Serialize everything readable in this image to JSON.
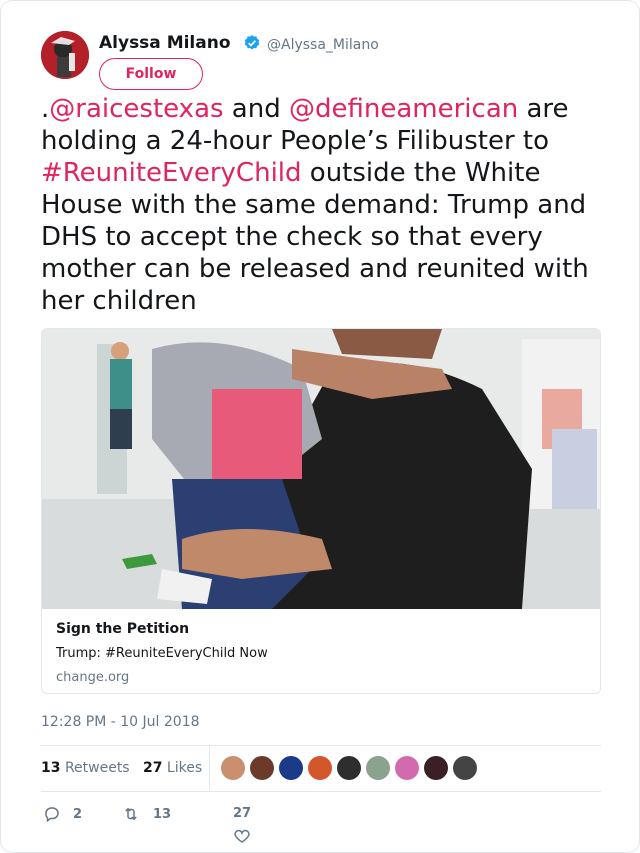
{
  "author": {
    "name": "Alyssa Milano",
    "handle": "@Alyssa_Milano",
    "follow_label": "Follow"
  },
  "tweet": {
    "parts": [
      {
        "text": ".",
        "link": false
      },
      {
        "text": "@raicestexas",
        "link": true
      },
      {
        "text": " and ",
        "link": false
      },
      {
        "text": "@defineamerican",
        "link": true
      },
      {
        "text": " are holding a 24-hour People’s Filibuster to ",
        "link": false
      },
      {
        "text": "#ReuniteEveryChild",
        "link": true
      },
      {
        "text": " outside the White House with the same demand: Trump and DHS to accept the check so that every mother can be released and reunited with her children",
        "link": false
      }
    ]
  },
  "card": {
    "title": "Sign the Petition",
    "description": "Trump: #ReuniteEveryChild Now",
    "domain": "change.org"
  },
  "timestamp": "12:28 PM - 10 Jul 2018",
  "stats": {
    "retweets_count": "13",
    "retweets_label": "Retweets",
    "likes_count": "27",
    "likes_label": "Likes"
  },
  "actions": {
    "reply_count": "2",
    "retweet_count": "13",
    "like_count": "27"
  },
  "colors": {
    "accent": "#e0245e",
    "muted": "#657786",
    "verified": "#1da1f2"
  },
  "liker_colors": [
    "#c98f6e",
    "#6b3a2a",
    "#1b3a8a",
    "#d4562b",
    "#2e2e2e",
    "#8aa28e",
    "#d36ab0",
    "#3a1f24",
    "#444444"
  ]
}
